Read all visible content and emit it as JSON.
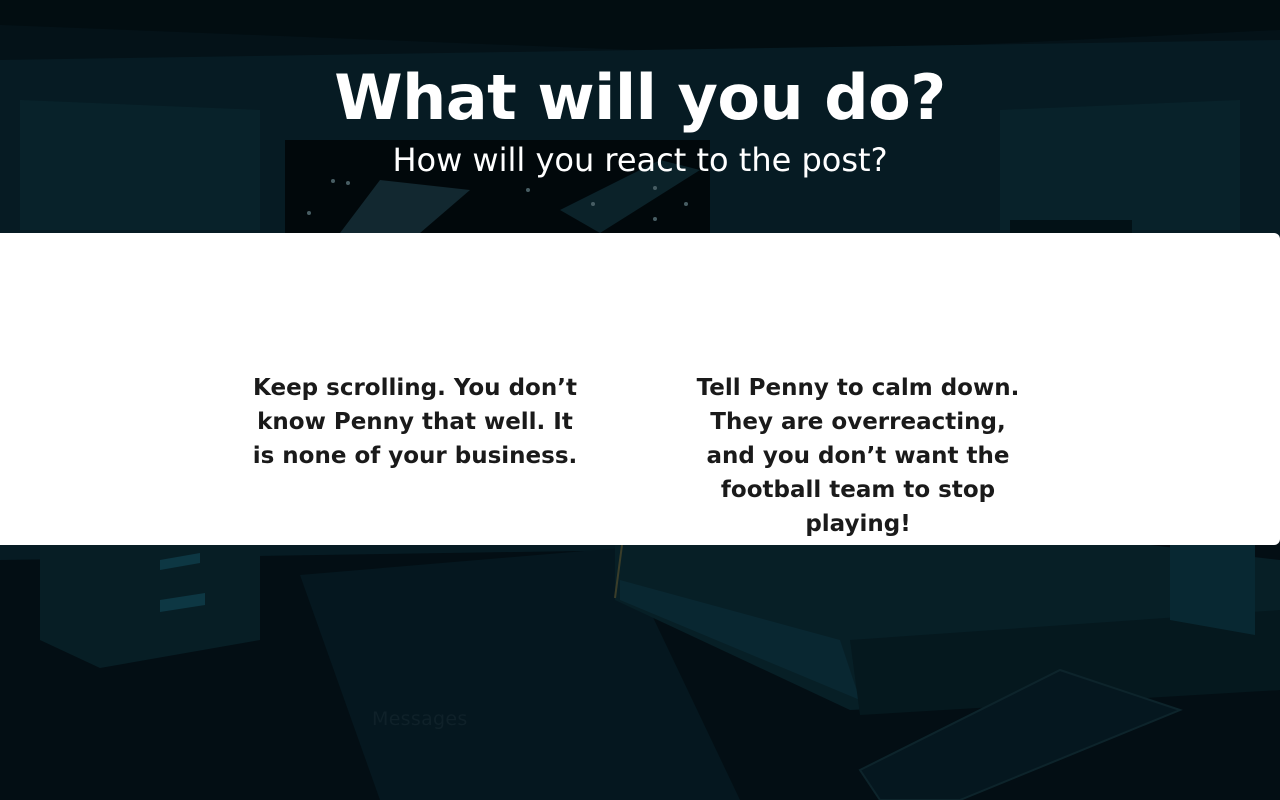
{
  "header": {
    "title": "What will you do?",
    "subtitle": "How will you react to the post?"
  },
  "choices": [
    {
      "text": "Keep scrolling. You don’t know Penny that well. It is none of your business."
    },
    {
      "text": "Tell Penny to calm down. They are overreacting, and you don’t want the football team to stop playing!"
    }
  ],
  "background": {
    "label": "Messages"
  },
  "colors": {
    "scene_dark": "#06141c",
    "scene_teal": "#0e3440",
    "panel": "#ffffff",
    "title_text": "#ffffff",
    "choice_text": "#1a1a1a"
  }
}
